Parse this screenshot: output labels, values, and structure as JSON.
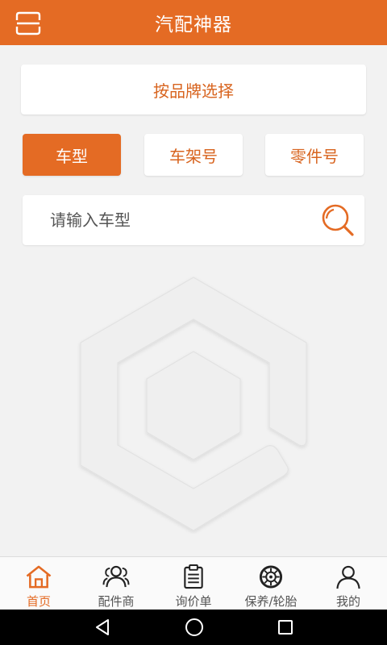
{
  "app_bar": {
    "title": "汽配神器",
    "menu_icon": "menu-icon"
  },
  "brand_select": {
    "label": "按品牌选择"
  },
  "tabs": [
    {
      "label": "车型",
      "active": true
    },
    {
      "label": "车架号",
      "active": false
    },
    {
      "label": "零件号",
      "active": false
    }
  ],
  "search": {
    "placeholder": "请输入车型",
    "value": "",
    "icon": "search-icon"
  },
  "bottom_nav": [
    {
      "label": "首页",
      "icon": "home-icon",
      "active": true
    },
    {
      "label": "配件商",
      "icon": "people-icon",
      "active": false
    },
    {
      "label": "询价单",
      "icon": "clipboard-icon",
      "active": false
    },
    {
      "label": "保养/轮胎",
      "icon": "tire-icon",
      "active": false
    },
    {
      "label": "我的",
      "icon": "person-icon",
      "active": false
    }
  ],
  "colors": {
    "accent": "#e46b24",
    "accent_text": "#d8641f",
    "background": "#f2f2f2"
  },
  "system_nav": [
    "back-icon",
    "home-circle-icon",
    "recents-icon"
  ]
}
